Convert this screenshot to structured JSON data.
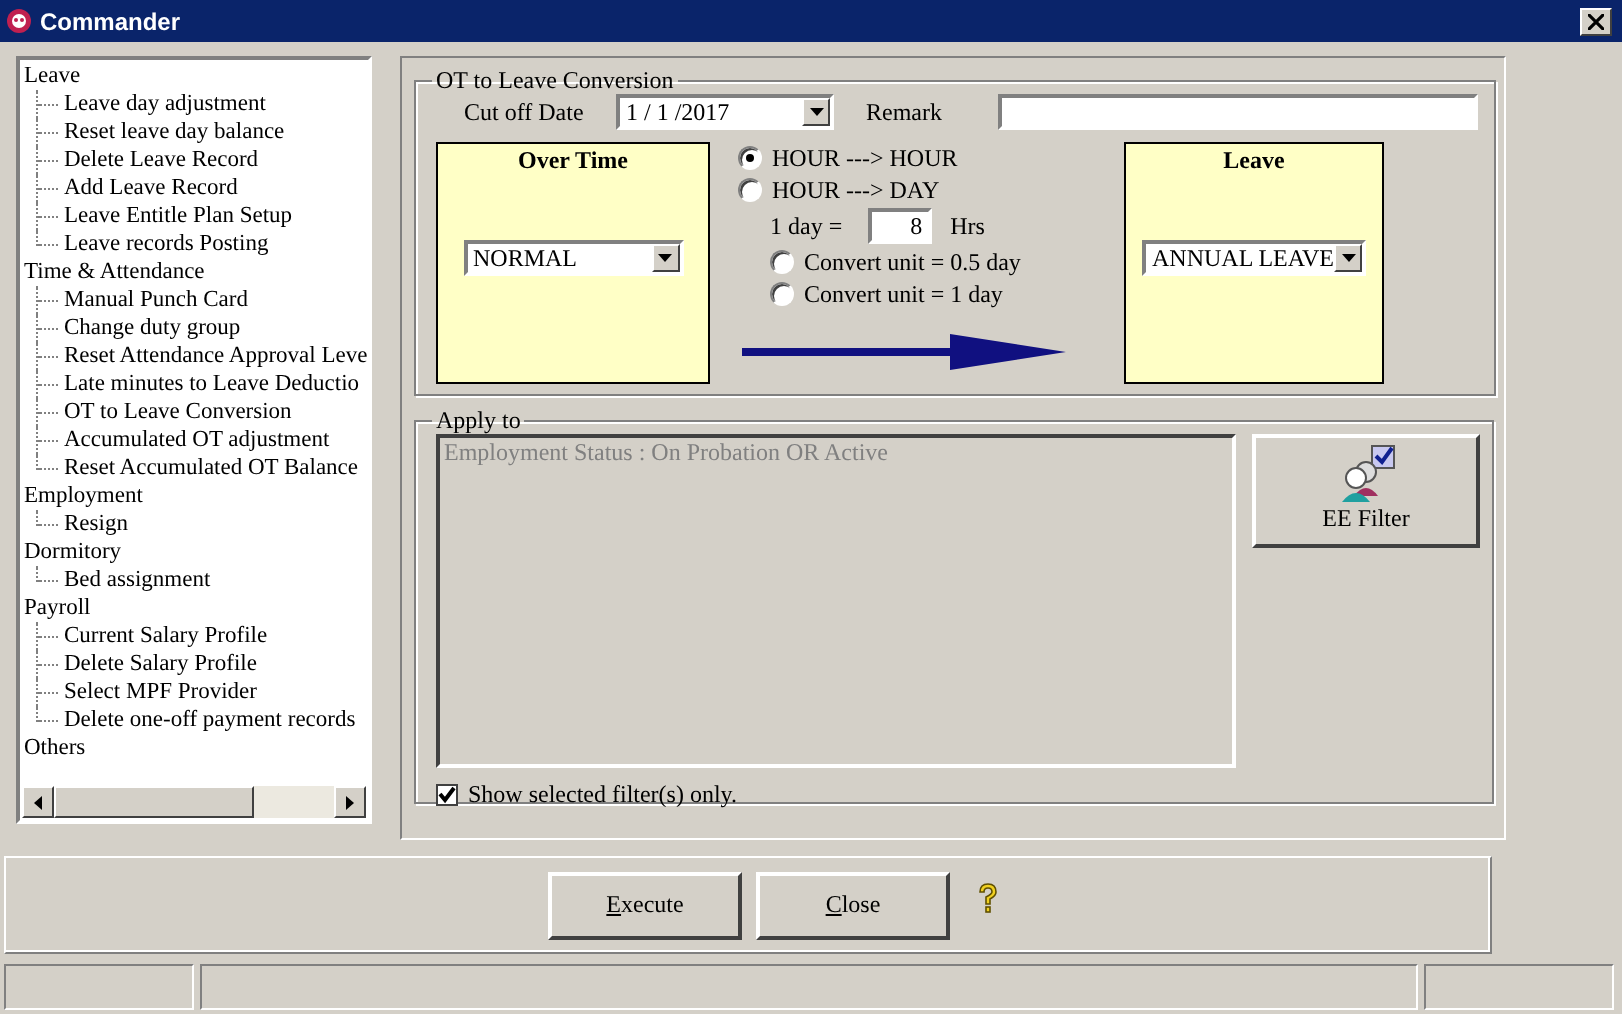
{
  "window": {
    "title": "Commander"
  },
  "tree": [
    {
      "label": "Leave",
      "children": [
        {
          "label": "Leave day adjustment"
        },
        {
          "label": "Reset leave day balance"
        },
        {
          "label": "Delete Leave Record"
        },
        {
          "label": "Add Leave Record"
        },
        {
          "label": "Leave Entitle Plan Setup"
        },
        {
          "label": "Leave records Posting"
        }
      ]
    },
    {
      "label": "Time & Attendance",
      "children": [
        {
          "label": "Manual Punch Card"
        },
        {
          "label": "Change duty group"
        },
        {
          "label": "Reset Attendance Approval Leve"
        },
        {
          "label": "Late minutes to Leave Deductio"
        },
        {
          "label": "OT to Leave Conversion"
        },
        {
          "label": "Accumulated OT adjustment"
        },
        {
          "label": "Reset Accumulated OT Balance"
        }
      ]
    },
    {
      "label": "Employment",
      "children": [
        {
          "label": "Resign"
        }
      ]
    },
    {
      "label": "Dormitory",
      "children": [
        {
          "label": "Bed assignment"
        }
      ]
    },
    {
      "label": "Payroll",
      "children": [
        {
          "label": "Current Salary Profile"
        },
        {
          "label": "Delete Salary Profile"
        },
        {
          "label": "Select MPF Provider"
        },
        {
          "label": "Delete one-off payment records"
        }
      ]
    },
    {
      "label": "Others"
    }
  ],
  "conversion": {
    "title": "OT to Leave Conversion",
    "cut_off_label": "Cut off Date",
    "cut_off_date": "1 / 1 /2017",
    "remark_label": "Remark",
    "overtime": {
      "title": "Over Time",
      "value": "NORMAL"
    },
    "modes": [
      {
        "label": "HOUR ---> HOUR",
        "selected": true
      },
      {
        "label": "HOUR ---> DAY",
        "selected": false
      }
    ],
    "day_label": "1 day =",
    "day_hours": "8",
    "hrs_label": "Hrs",
    "units": [
      {
        "label": "Convert unit = 0.5 day",
        "selected": false
      },
      {
        "label": "Convert unit = 1 day",
        "selected": false
      }
    ],
    "leave": {
      "title": "Leave",
      "value": "ANNUAL LEAVE"
    }
  },
  "apply": {
    "title": "Apply to",
    "filter_text": "Employment Status : On Probation OR Active",
    "filter_button": "EE Filter",
    "show_selected": {
      "label": "Show selected filter(s) only.",
      "checked": true
    }
  },
  "buttons": [
    {
      "label": "Execute"
    },
    {
      "label": "Close"
    }
  ]
}
